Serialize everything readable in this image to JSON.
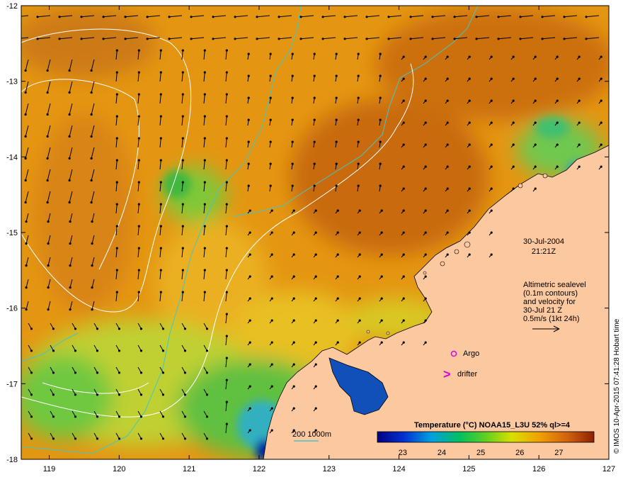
{
  "map": {
    "lon_ticks": [
      "119",
      "120",
      "121",
      "122",
      "123",
      "124",
      "125",
      "126",
      "127"
    ],
    "lat_ticks": [
      "-12",
      "-13",
      "-14",
      "-15",
      "-16",
      "-17",
      "-18"
    ],
    "lon_range": [
      118.6,
      127.0
    ],
    "lat_range": [
      -12.0,
      -18.0
    ]
  },
  "annotation": {
    "date": "30-Jul-2004",
    "time": "21:21Z",
    "alt_lines": [
      "Altimetric sealevel",
      "(0.1m contours)",
      "and velocity for",
      "30-Jul 21 Z",
      "0.5m/s (1kt 24h)"
    ]
  },
  "legend": {
    "argo_label": "Argo",
    "drifter_label": "drifter",
    "argo_color": "#e000e0",
    "drifter_color": "#e000e0",
    "bathy_label": "200  1000m",
    "bathy_color": "#40c8c8"
  },
  "colorbar": {
    "title": "Temperature (°C) NOAA15_L3U 52% ql>=4",
    "ticks": [
      "23",
      "24",
      "25",
      "26",
      "27"
    ]
  },
  "credit": "© IMOS 10-Apr-2015 07:41:28 Hobart time",
  "colors": {
    "land": "#fcc8a0",
    "sst_warm": "#e09010",
    "sst_cool": "#50c840"
  }
}
